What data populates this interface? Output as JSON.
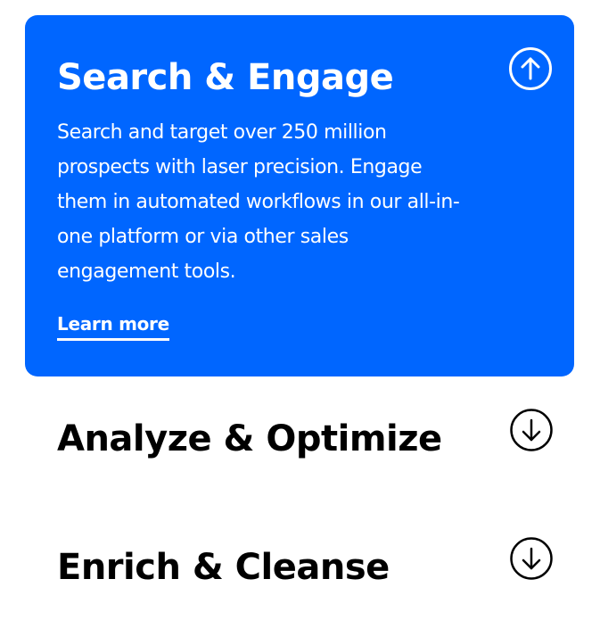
{
  "accordion": {
    "active": {
      "title": "Search & Engage",
      "description": "Search and target over 250 million prospects with laser precision. Engage them in automated workflows in our all-in-one platform or via other sales engagement tools.",
      "link_label": "Learn more",
      "toggle_icon": "arrow-up-circle-icon",
      "background_color": "#0066ff",
      "text_color": "#ffffff"
    },
    "items": [
      {
        "title": "Analyze & Optimize",
        "toggle_icon": "arrow-down-circle-icon"
      },
      {
        "title": "Enrich & Cleanse",
        "toggle_icon": "arrow-down-circle-icon"
      }
    ]
  }
}
